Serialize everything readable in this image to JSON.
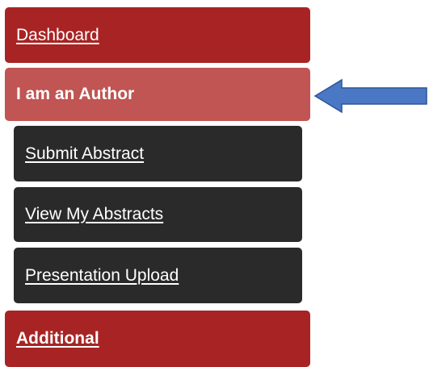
{
  "nav": {
    "dashboard_label": "Dashboard",
    "author_label": "I am an Author",
    "sub_items": [
      {
        "label": "Submit Abstract"
      },
      {
        "label": "View My Abstracts"
      },
      {
        "label": "Presentation Upload"
      }
    ],
    "additional_label": "Additional"
  },
  "colors": {
    "primary_red": "#a82424",
    "active_red": "#c05553",
    "submenu_dark": "#2a2a2a",
    "arrow_blue": "#4a78c4"
  },
  "icons": {
    "pointer": "left-arrow-icon"
  }
}
